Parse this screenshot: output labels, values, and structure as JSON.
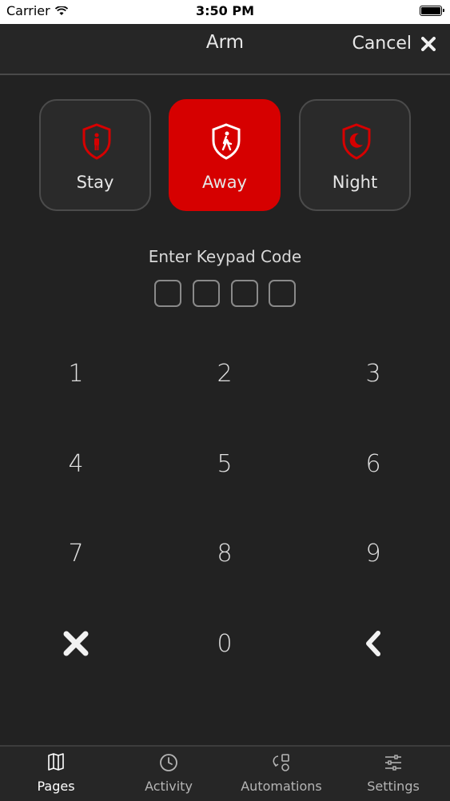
{
  "status_bar": {
    "carrier": "Carrier",
    "time": "3:50 PM"
  },
  "header": {
    "title": "Arm",
    "cancel_label": "Cancel"
  },
  "modes": [
    {
      "label": "Stay",
      "icon": "shield-person-icon",
      "active": false
    },
    {
      "label": "Away",
      "icon": "shield-walking-icon",
      "active": true
    },
    {
      "label": "Night",
      "icon": "shield-moon-icon",
      "active": false
    }
  ],
  "keypad_code": {
    "label": "Enter Keypad Code",
    "digits_entered": 0,
    "digits_total": 4
  },
  "keypad": {
    "keys": [
      "1",
      "2",
      "3",
      "4",
      "5",
      "6",
      "7",
      "8",
      "9",
      "0"
    ],
    "clear_icon": "close-x-icon",
    "backspace_icon": "chevron-left-icon"
  },
  "tabbar": {
    "tabs": [
      {
        "label": "Pages",
        "icon": "book-icon",
        "active": true
      },
      {
        "label": "Activity",
        "icon": "clock-icon",
        "active": false
      },
      {
        "label": "Automations",
        "icon": "automation-icon",
        "active": false
      },
      {
        "label": "Settings",
        "icon": "sliders-icon",
        "active": false
      }
    ]
  },
  "colors": {
    "accent": "#d60000",
    "background": "#222222"
  }
}
